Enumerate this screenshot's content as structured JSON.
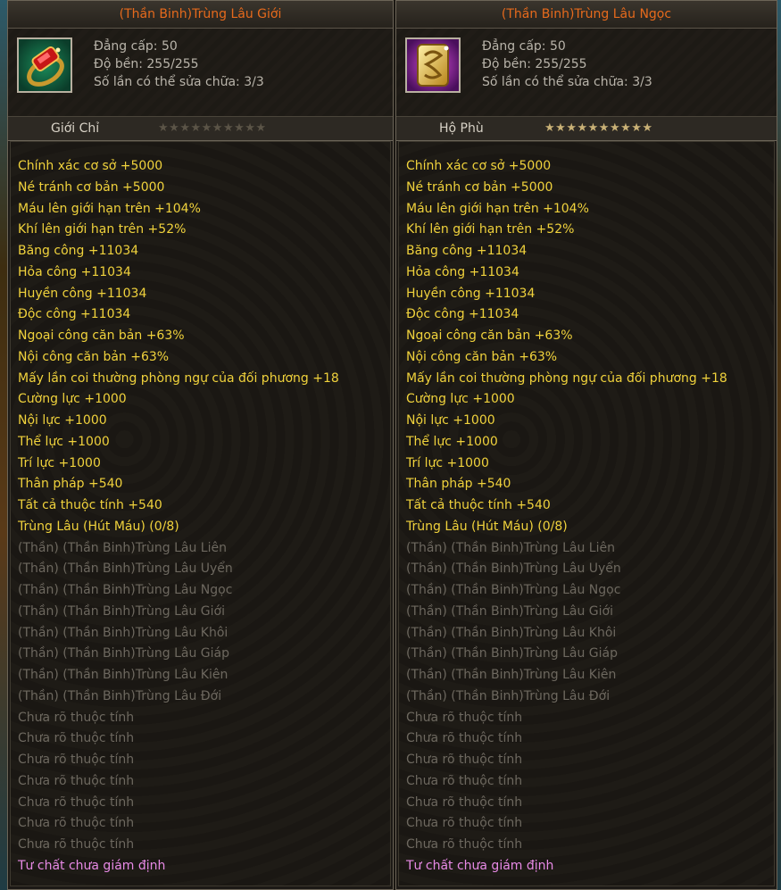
{
  "colors": {
    "title": "#e66a1c",
    "active_property": "#f0d23c",
    "inactive_property": "#6d685f",
    "appraisal": "#e88ae6",
    "star_on": "#c9b176",
    "star_off": "#5b5447"
  },
  "left": {
    "title": "(Thần Binh)Trùng Lâu Giới",
    "icon": "red-ring-icon",
    "level": "Đẳng cấp: 50",
    "durability": "Độ bền: 255/255",
    "repair": "Số lần có thể sửa chữa: 3/3",
    "type": "Giới Chỉ",
    "stars_total": 10,
    "stars_on": 0,
    "properties": [
      {
        "text": "Chính xác cơ sở +5000",
        "style": "yellow"
      },
      {
        "text": "Né tránh cơ bản +5000",
        "style": "yellow"
      },
      {
        "text": "Máu lên giới hạn trên +104%",
        "style": "yellow"
      },
      {
        "text": "Khí lên giới hạn trên +52%",
        "style": "yellow"
      },
      {
        "text": "Băng công +11034",
        "style": "yellow"
      },
      {
        "text": "Hỏa công +11034",
        "style": "yellow"
      },
      {
        "text": "Huyền công +11034",
        "style": "yellow"
      },
      {
        "text": "Độc công +11034",
        "style": "yellow"
      },
      {
        "text": "Ngoại công căn bản +63%",
        "style": "yellow"
      },
      {
        "text": "Nội công căn bản +63%",
        "style": "yellow"
      },
      {
        "text": "Mấy lần coi thường phòng ngự của đối phương +18",
        "style": "yellow"
      },
      {
        "text": "Cường lực +1000",
        "style": "yellow"
      },
      {
        "text": "Nội lực +1000",
        "style": "yellow"
      },
      {
        "text": "Thể lực +1000",
        "style": "yellow"
      },
      {
        "text": "Trí lực +1000",
        "style": "yellow"
      },
      {
        "text": "Thân pháp +540",
        "style": "yellow"
      },
      {
        "text": "Tất cả thuộc tính +540",
        "style": "yellow"
      },
      {
        "text": "Trùng Lâu (Hút Máu) (0/8)",
        "style": "yellow"
      },
      {
        "text": "(Thần) (Thần Binh)Trùng Lâu Liên",
        "style": "gray"
      },
      {
        "text": "(Thần) (Thần Binh)Trùng Lâu Uyển",
        "style": "gray"
      },
      {
        "text": "(Thần) (Thần Binh)Trùng Lâu Ngọc",
        "style": "gray"
      },
      {
        "text": "(Thần) (Thần Binh)Trùng Lâu Giới",
        "style": "gray"
      },
      {
        "text": "(Thần) (Thần Binh)Trùng Lâu Khôi",
        "style": "gray"
      },
      {
        "text": "(Thần) (Thần Binh)Trùng Lâu Giáp",
        "style": "gray"
      },
      {
        "text": "(Thần) (Thần Binh)Trùng Lâu Kiên",
        "style": "gray"
      },
      {
        "text": "(Thần) (Thần Binh)Trùng Lâu Đới",
        "style": "gray"
      },
      {
        "text": "Chưa rõ thuộc tính",
        "style": "gray"
      },
      {
        "text": "Chưa rõ thuộc tính",
        "style": "gray"
      },
      {
        "text": "Chưa rõ thuộc tính",
        "style": "gray"
      },
      {
        "text": "Chưa rõ thuộc tính",
        "style": "gray"
      },
      {
        "text": "Chưa rõ thuộc tính",
        "style": "gray"
      },
      {
        "text": "Chưa rõ thuộc tính",
        "style": "gray"
      },
      {
        "text": "Chưa rõ thuộc tính",
        "style": "gray"
      },
      {
        "text": "Tư chất chưa giám định",
        "style": "pink"
      }
    ]
  },
  "right": {
    "title": "(Thần Binh)Trùng Lâu Ngọc",
    "icon": "gold-jade-pendant-icon",
    "level": "Đẳng cấp: 50",
    "durability": "Độ bền: 255/255",
    "repair": "Số lần có thể sửa chữa: 3/3",
    "type": "Hộ Phù",
    "stars_total": 10,
    "stars_on": 10,
    "properties": [
      {
        "text": "Chính xác cơ sở +5000",
        "style": "yellow"
      },
      {
        "text": "Né tránh cơ bản +5000",
        "style": "yellow"
      },
      {
        "text": "Máu lên giới hạn trên +104%",
        "style": "yellow"
      },
      {
        "text": "Khí lên giới hạn trên +52%",
        "style": "yellow"
      },
      {
        "text": "Băng công +11034",
        "style": "yellow"
      },
      {
        "text": "Hỏa công +11034",
        "style": "yellow"
      },
      {
        "text": "Huyền công +11034",
        "style": "yellow"
      },
      {
        "text": "Độc công +11034",
        "style": "yellow"
      },
      {
        "text": "Ngoại công căn bản +63%",
        "style": "yellow"
      },
      {
        "text": "Nội công căn bản +63%",
        "style": "yellow"
      },
      {
        "text": "Mấy lần coi thường phòng ngự của đối phương +18",
        "style": "yellow"
      },
      {
        "text": "Cường lực +1000",
        "style": "yellow"
      },
      {
        "text": "Nội lực +1000",
        "style": "yellow"
      },
      {
        "text": "Thể lực +1000",
        "style": "yellow"
      },
      {
        "text": "Trí lực +1000",
        "style": "yellow"
      },
      {
        "text": "Thân pháp +540",
        "style": "yellow"
      },
      {
        "text": "Tất cả thuộc tính +540",
        "style": "yellow"
      },
      {
        "text": "Trùng Lâu (Hút Máu) (0/8)",
        "style": "yellow"
      },
      {
        "text": "(Thần) (Thần Binh)Trùng Lâu Liên",
        "style": "gray"
      },
      {
        "text": "(Thần) (Thần Binh)Trùng Lâu Uyển",
        "style": "gray"
      },
      {
        "text": "(Thần) (Thần Binh)Trùng Lâu Ngọc",
        "style": "gray"
      },
      {
        "text": "(Thần) (Thần Binh)Trùng Lâu Giới",
        "style": "gray"
      },
      {
        "text": "(Thần) (Thần Binh)Trùng Lâu Khôi",
        "style": "gray"
      },
      {
        "text": "(Thần) (Thần Binh)Trùng Lâu Giáp",
        "style": "gray"
      },
      {
        "text": "(Thần) (Thần Binh)Trùng Lâu Kiên",
        "style": "gray"
      },
      {
        "text": "(Thần) (Thần Binh)Trùng Lâu Đới",
        "style": "gray"
      },
      {
        "text": "Chưa rõ thuộc tính",
        "style": "gray"
      },
      {
        "text": "Chưa rõ thuộc tính",
        "style": "gray"
      },
      {
        "text": "Chưa rõ thuộc tính",
        "style": "gray"
      },
      {
        "text": "Chưa rõ thuộc tính",
        "style": "gray"
      },
      {
        "text": "Chưa rõ thuộc tính",
        "style": "gray"
      },
      {
        "text": "Chưa rõ thuộc tính",
        "style": "gray"
      },
      {
        "text": "Chưa rõ thuộc tính",
        "style": "gray"
      },
      {
        "text": "Tư chất chưa giám định",
        "style": "pink"
      }
    ]
  }
}
